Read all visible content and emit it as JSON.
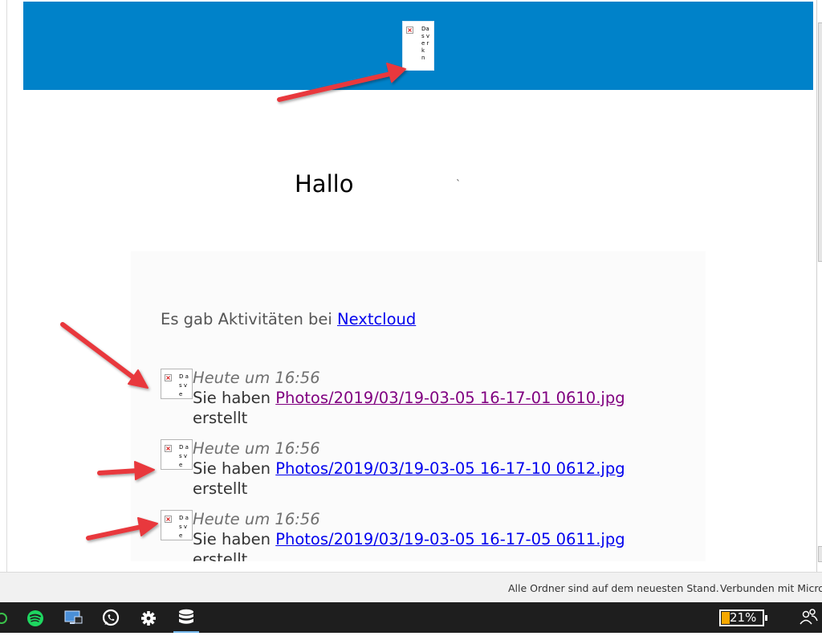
{
  "header": {
    "logo_alt": "Das ve rk n",
    "color": "#0082c9"
  },
  "greeting": {
    "text": "Hallo",
    "mark": "`"
  },
  "activity": {
    "intro_prefix": "Es gab Aktivitäten bei ",
    "intro_link": "Nextcloud",
    "entries": [
      {
        "icon_alt": "D as ve",
        "time": "Heute um 16:56",
        "prefix": "Sie haben ",
        "link": "Photos/2019/03/19-03-05 16-17-01 0610.jpg",
        "suffix": "erstellt",
        "visited": true
      },
      {
        "icon_alt": "D as ve",
        "time": "Heute um 16:56",
        "prefix": "Sie haben ",
        "link": "Photos/2019/03/19-03-05 16-17-10 0612.jpg",
        "suffix": "erstellt",
        "visited": false
      },
      {
        "icon_alt": "D as ve",
        "time": "Heute um 16:56",
        "prefix": "Sie haben ",
        "link": "Photos/2019/03/19-03-05 16-17-05 0611.jpg",
        "suffix": "erstellt",
        "visited": false
      }
    ]
  },
  "status_bar": {
    "sync_status": "Alle Ordner sind auf dem neuesten Stand.",
    "connection": "Verbunden mit Micros"
  },
  "taskbar": {
    "icons": [
      "spotify-icon",
      "remote-desktop-icon",
      "whatsapp-icon",
      "gear-icon",
      "database-icon"
    ],
    "battery_label": "21%",
    "battery_level": 0.21,
    "battery_color": "#f7a800"
  },
  "annotation_color": "#e8393d"
}
